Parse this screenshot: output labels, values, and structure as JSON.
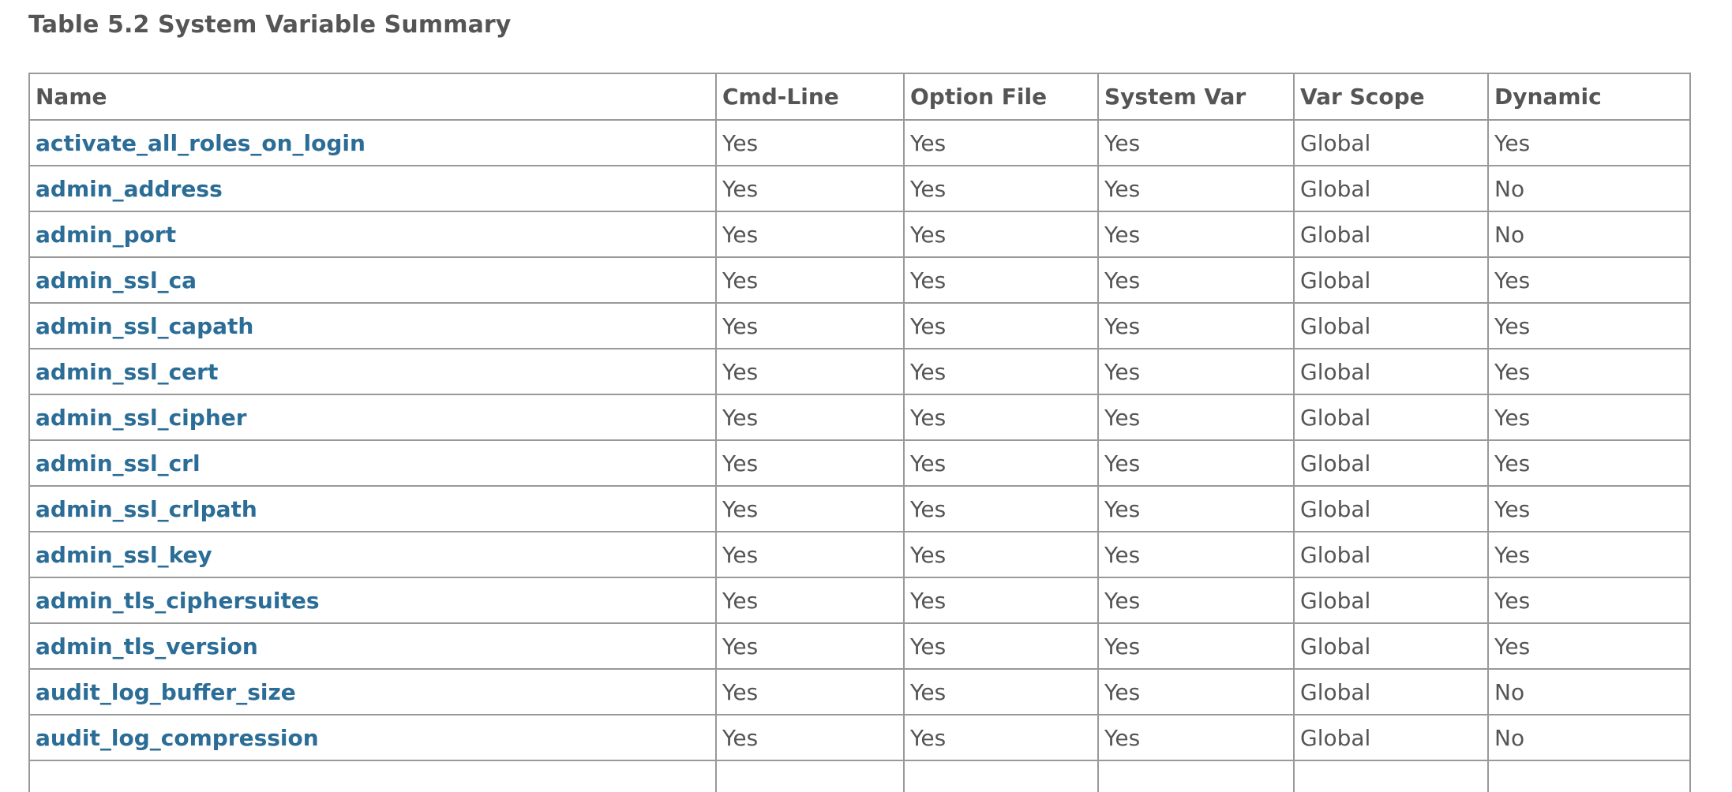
{
  "caption": "Table 5.2 System Variable Summary",
  "table": {
    "headers": [
      "Name",
      "Cmd-Line",
      "Option File",
      "System Var",
      "Var Scope",
      "Dynamic"
    ],
    "rows": [
      [
        "activate_all_roles_on_login",
        "Yes",
        "Yes",
        "Yes",
        "Global",
        "Yes"
      ],
      [
        "admin_address",
        "Yes",
        "Yes",
        "Yes",
        "Global",
        "No"
      ],
      [
        "admin_port",
        "Yes",
        "Yes",
        "Yes",
        "Global",
        "No"
      ],
      [
        "admin_ssl_ca",
        "Yes",
        "Yes",
        "Yes",
        "Global",
        "Yes"
      ],
      [
        "admin_ssl_capath",
        "Yes",
        "Yes",
        "Yes",
        "Global",
        "Yes"
      ],
      [
        "admin_ssl_cert",
        "Yes",
        "Yes",
        "Yes",
        "Global",
        "Yes"
      ],
      [
        "admin_ssl_cipher",
        "Yes",
        "Yes",
        "Yes",
        "Global",
        "Yes"
      ],
      [
        "admin_ssl_crl",
        "Yes",
        "Yes",
        "Yes",
        "Global",
        "Yes"
      ],
      [
        "admin_ssl_crlpath",
        "Yes",
        "Yes",
        "Yes",
        "Global",
        "Yes"
      ],
      [
        "admin_ssl_key",
        "Yes",
        "Yes",
        "Yes",
        "Global",
        "Yes"
      ],
      [
        "admin_tls_ciphersuites",
        "Yes",
        "Yes",
        "Yes",
        "Global",
        "Yes"
      ],
      [
        "admin_tls_version",
        "Yes",
        "Yes",
        "Yes",
        "Global",
        "Yes"
      ],
      [
        "audit_log_buffer_size",
        "Yes",
        "Yes",
        "Yes",
        "Global",
        "No"
      ],
      [
        "audit_log_compression",
        "Yes",
        "Yes",
        "Yes",
        "Global",
        "No"
      ],
      [
        "",
        "",
        "",
        "",
        "",
        ""
      ]
    ]
  },
  "colors": {
    "text": "#555555",
    "link": "#2b6d96",
    "border": "#999999"
  }
}
